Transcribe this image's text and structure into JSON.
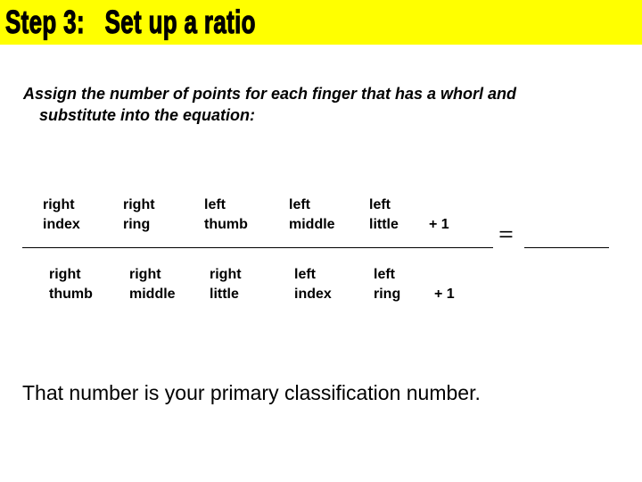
{
  "header": {
    "title": "Step 3:   Set up a ratio",
    "background_color": "#ffff00"
  },
  "instructions": {
    "line1": "Assign the number of points for each finger that has a whorl and",
    "line2": "substitute into the equation:"
  },
  "equation": {
    "numerator": [
      {
        "side": "right",
        "finger": "index"
      },
      {
        "side": "right",
        "finger": "ring"
      },
      {
        "side": "left",
        "finger": "thumb"
      },
      {
        "side": "left",
        "finger": "middle"
      },
      {
        "side": "left",
        "finger": "little"
      }
    ],
    "numerator_constant": "+ 1",
    "denominator": [
      {
        "side": "right",
        "finger": "thumb"
      },
      {
        "side": "right",
        "finger": "middle"
      },
      {
        "side": "right",
        "finger": "little"
      },
      {
        "side": "left",
        "finger": "index"
      },
      {
        "side": "left",
        "finger": "ring"
      }
    ],
    "denominator_constant": "+ 1",
    "equals_sign": "="
  },
  "footer": {
    "text": "That number is your primary classification number."
  }
}
